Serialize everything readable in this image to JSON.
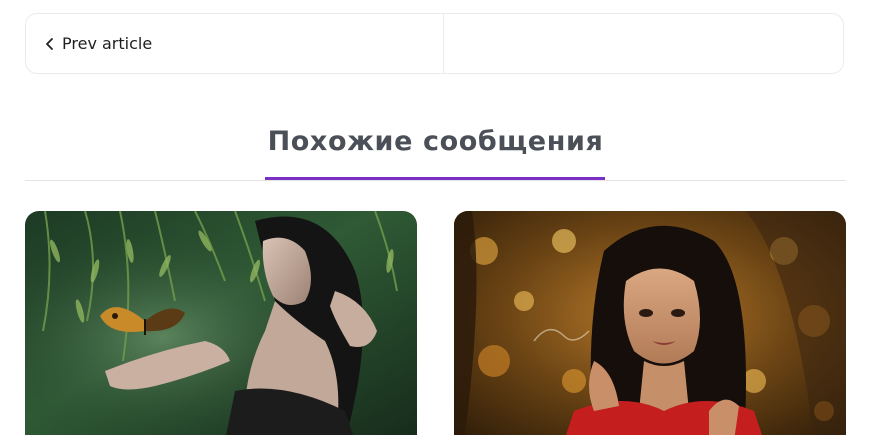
{
  "post_nav": {
    "prev_label": "Prev article",
    "next_label": ""
  },
  "related": {
    "heading": "Похожие сообщения",
    "accent_color": "#7b2fc6"
  },
  "cards": [
    {
      "image": "woman-with-butterfly-in-forest"
    },
    {
      "image": "woman-portrait-autumn-trees"
    }
  ],
  "icons": {
    "prev": "chevron-left-icon"
  }
}
